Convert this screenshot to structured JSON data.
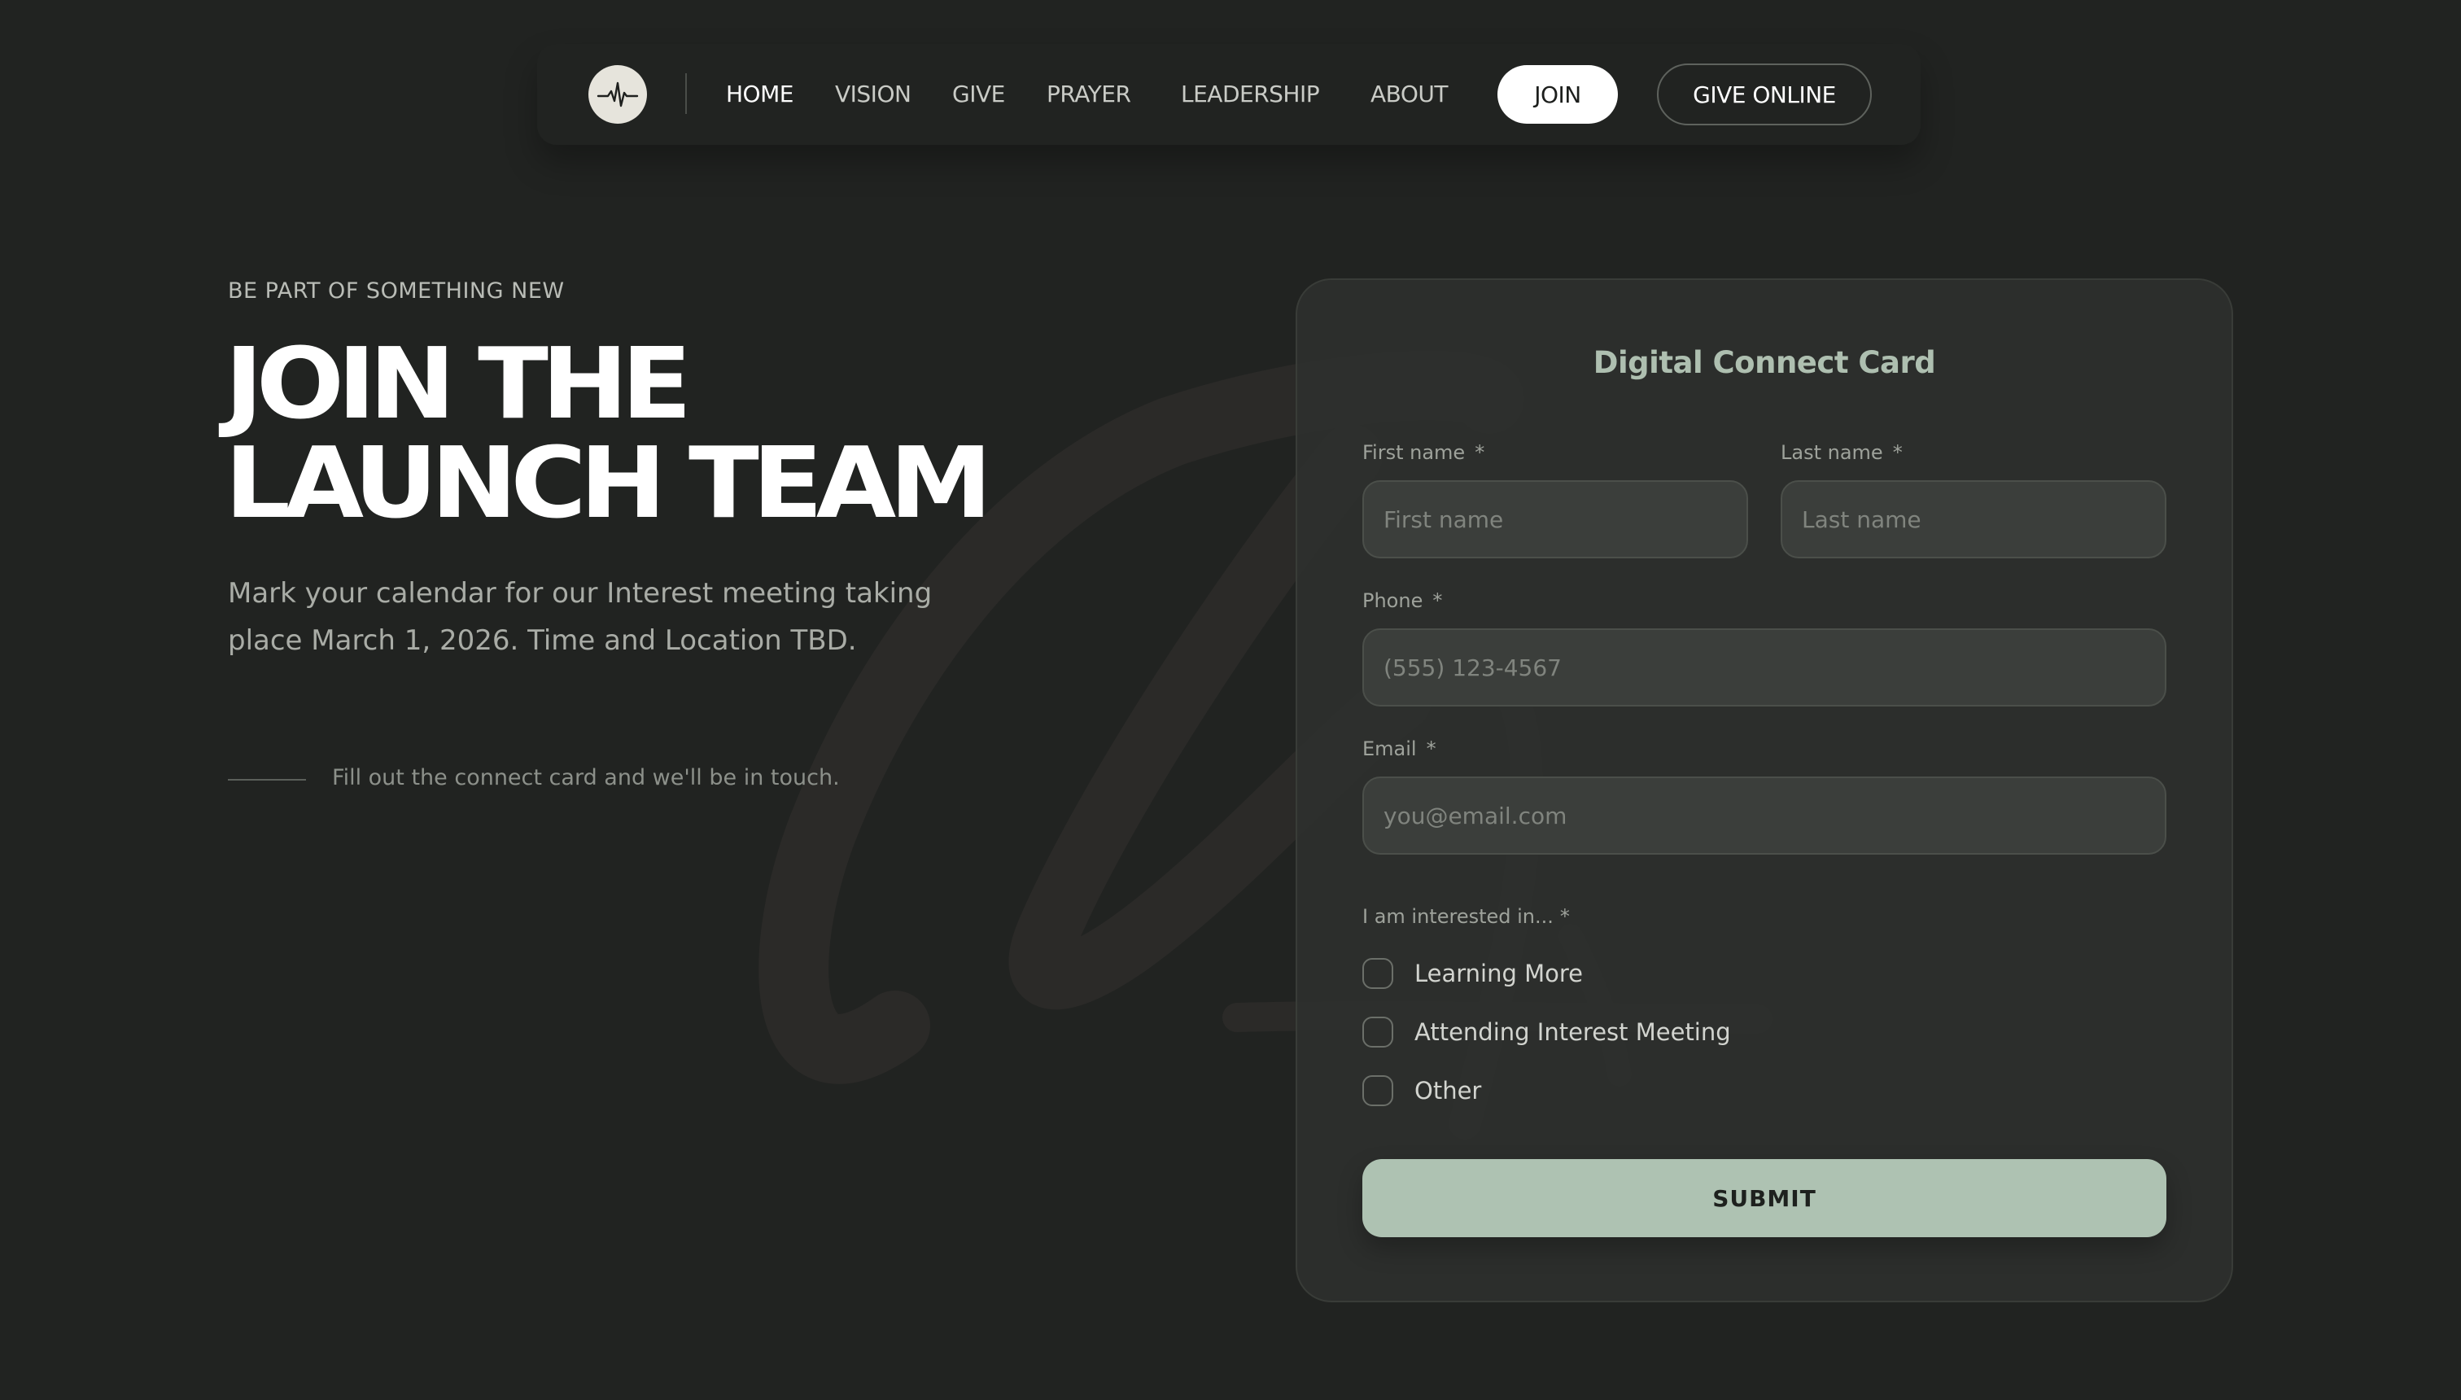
{
  "nav": {
    "logo_icon": "heartbeat-icon",
    "links": [
      "HOME",
      "VISION",
      "GIVE",
      "PRAYER",
      "LEADERSHIP",
      "ABOUT"
    ],
    "active": "HOME",
    "join_label": "JOIN",
    "give_online_label": "GIVE ONLINE"
  },
  "hero": {
    "eyebrow": "BE PART OF SOMETHING NEW",
    "headline_line1": "JOIN THE",
    "headline_line2": "LAUNCH TEAM",
    "intro": "Mark your calendar for our Interest meeting taking place March 1, 2026. Time and Location TBD.",
    "note": "Fill out the connect card and we'll be in touch."
  },
  "form": {
    "title": "Digital Connect Card",
    "required_mark": "*",
    "first_name": {
      "label": "First name",
      "placeholder": "First name",
      "value": ""
    },
    "last_name": {
      "label": "Last name",
      "placeholder": "Last name",
      "value": ""
    },
    "phone": {
      "label": "Phone",
      "placeholder": "(555) 123-4567",
      "value": ""
    },
    "email": {
      "label": "Email",
      "placeholder": "you@email.com",
      "value": ""
    },
    "interest": {
      "label": "I am interested in...",
      "options": [
        "Learning More",
        "Attending Interest Meeting",
        "Other"
      ]
    },
    "submit_label": "SUBMIT"
  },
  "colors": {
    "background": "#212321",
    "card": "#2e312e",
    "accent": "#aec2b2",
    "card_title": "#aebfb0"
  }
}
